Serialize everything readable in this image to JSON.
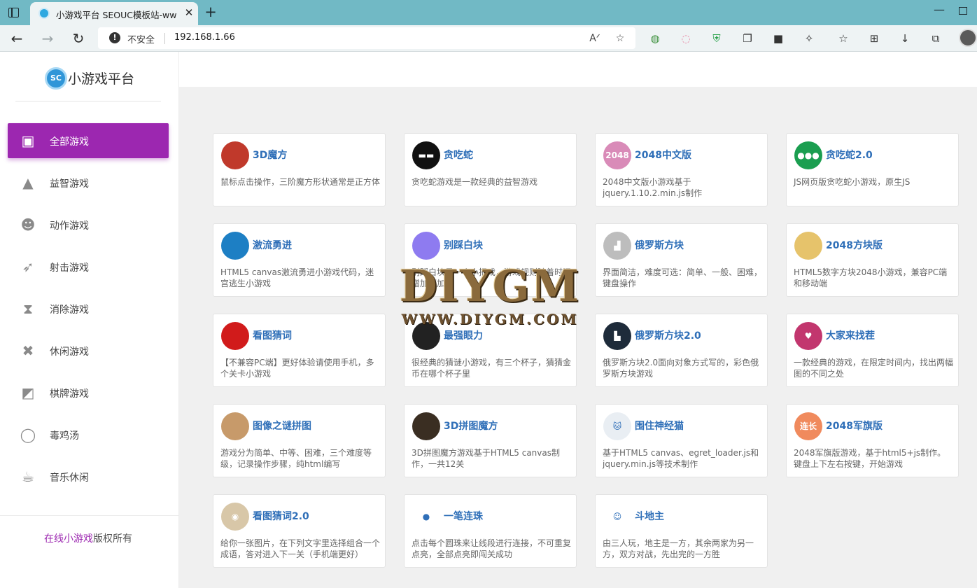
{
  "browser": {
    "tab_title": "小游戏平台 SEOUC模板站-www.s",
    "address_security": "不安全",
    "url": "192.168.1.66"
  },
  "sidebar": {
    "logo_icon_text": "SC",
    "logo_text": "小游戏平台",
    "items": [
      {
        "label": "全部游戏",
        "icon": "twitch-icon",
        "active": true
      },
      {
        "label": "益智游戏",
        "icon": "graduation-cap-icon"
      },
      {
        "label": "动作游戏",
        "icon": "reddit-alien-icon"
      },
      {
        "label": "射击游戏",
        "icon": "rocket-icon"
      },
      {
        "label": "消除游戏",
        "icon": "hourglass-icon"
      },
      {
        "label": "休闲游戏",
        "icon": "pinwheel-icon"
      },
      {
        "label": "棋牌游戏",
        "icon": "chessboard-icon"
      },
      {
        "label": "毒鸡汤",
        "icon": "user-circle-icon"
      },
      {
        "label": "音乐休闲",
        "icon": "coffee-cup-icon"
      }
    ],
    "footer_highlight": "在线小游戏",
    "footer_rest": "版权所有"
  },
  "watermark": {
    "main": "DIYGM",
    "sub": "WWW.DIYGM.COM"
  },
  "games": [
    {
      "title": "3D魔方",
      "desc": "鼠标点击操作，三阶魔方形状通常是正方体",
      "icon": "rubiks-cube-icon",
      "icon_text": "",
      "color": "#c0392b"
    },
    {
      "title": "贪吃蛇",
      "desc": "贪吃蛇游戏是一款经典的益智游戏",
      "icon": "snake-icon",
      "icon_text": "▬▬",
      "color": "#111111"
    },
    {
      "title": "2048中文版",
      "desc": "2048中文版小游戏基于jquery.1.10.2.min.js制作",
      "icon": "tile-2048-icon",
      "icon_text": "2048",
      "color": "#d98bb8"
    },
    {
      "title": "贪吃蛇2.0",
      "desc": "JS网页版贪吃蛇小游戏，原生JS",
      "icon": "snake-dots-icon",
      "icon_text": "●●●",
      "color": "#1b9e50"
    },
    {
      "title": "激流勇进",
      "desc": "HTML5 canvas激流勇进小游戏代码，迷宫逃生小游戏",
      "icon": "stairs-icon",
      "icon_text": "",
      "color": "#1d7fc4"
    },
    {
      "title": "别踩白块",
      "desc": "别踩白块是一个小把戏，游戏规则随着时间增加而加快",
      "icon": "white-tile-icon",
      "icon_text": "",
      "color": "#8e7bf0"
    },
    {
      "title": "俄罗斯方块",
      "desc": "界面简洁，难度可选：简单、一般、困难，键盘操作",
      "icon": "tetris-icon",
      "icon_text": "▟",
      "color": "#bdbdbd"
    },
    {
      "title": "2048方块版",
      "desc": "HTML5数字方块2048小游戏，兼容PC端和移动端",
      "icon": "color-grid-icon",
      "icon_text": "",
      "color": "#e6c36b"
    },
    {
      "title": "看图猜词",
      "desc": "【不兼容PC端】更好体验请使用手机，多个关卡小游戏",
      "icon": "cola-bottle-icon",
      "icon_text": "",
      "color": "#d11b1b"
    },
    {
      "title": "最强眼力",
      "desc": "很经典的猜谜小游戏，有三个杯子，猜猜金币在哪个杯子里",
      "icon": "magic-hat-icon",
      "icon_text": "",
      "color": "#222222"
    },
    {
      "title": "俄罗斯方块2.0",
      "desc": "俄罗斯方块2.0面向对象方式写的，彩色俄罗斯方块游戏",
      "icon": "tetris-blue-icon",
      "icon_text": "▙",
      "color": "#1e2b3a"
    },
    {
      "title": "大家来找茬",
      "desc": "一款经典的游戏，在限定时间内，找出两幅图的不同之处",
      "icon": "heart-icon",
      "icon_text": "♥",
      "color": "#c2366e"
    },
    {
      "title": "图像之谜拼图",
      "desc": "游戏分为简单、中等、困难，三个难度等级，记录操作步骤，纯html编写",
      "icon": "jigsaw-photo-icon",
      "icon_text": "",
      "color": "#c79a6a"
    },
    {
      "title": "3D拼图魔方",
      "desc": "3D拼图魔方游戏基于HTML5 canvas制作，一共12关",
      "icon": "puzzle-cube-icon",
      "icon_text": "",
      "color": "#3a2e22"
    },
    {
      "title": "围住神经猫",
      "desc": "基于HTML5 canvas、egret_loader.js和jquery.min.js等技术制作",
      "icon": "cat-icon",
      "icon_text": "🐱",
      "color": "#e9eef3"
    },
    {
      "title": "2048军旗版",
      "desc": "2048军旗版游戏，基于html5+js制作。键盘上下左右按键，开始游戏",
      "icon": "army-flag-icon",
      "icon_text": "连长",
      "color": "#f08a5d"
    },
    {
      "title": "看图猜词2.0",
      "desc": "给你一张图片，在下列文字里选择组合一个成语，答对进入下一关（手机端更好）",
      "icon": "eye-icon",
      "icon_text": "◉",
      "color": "#d8c7a8"
    },
    {
      "title": "一笔连珠",
      "desc": "点击每个圆珠来让线段进行连接，不可重复点亮，全部点亮即闯关成功",
      "icon": "blue-bead-icon",
      "icon_text": "●",
      "color": "#ffffff"
    },
    {
      "title": "斗地主",
      "desc": "由三人玩，地主是一方，其余两家为另一方，双方对战，先出完的一方胜",
      "icon": "cartoon-man-icon",
      "icon_text": "☺",
      "color": "#ffffff"
    }
  ]
}
